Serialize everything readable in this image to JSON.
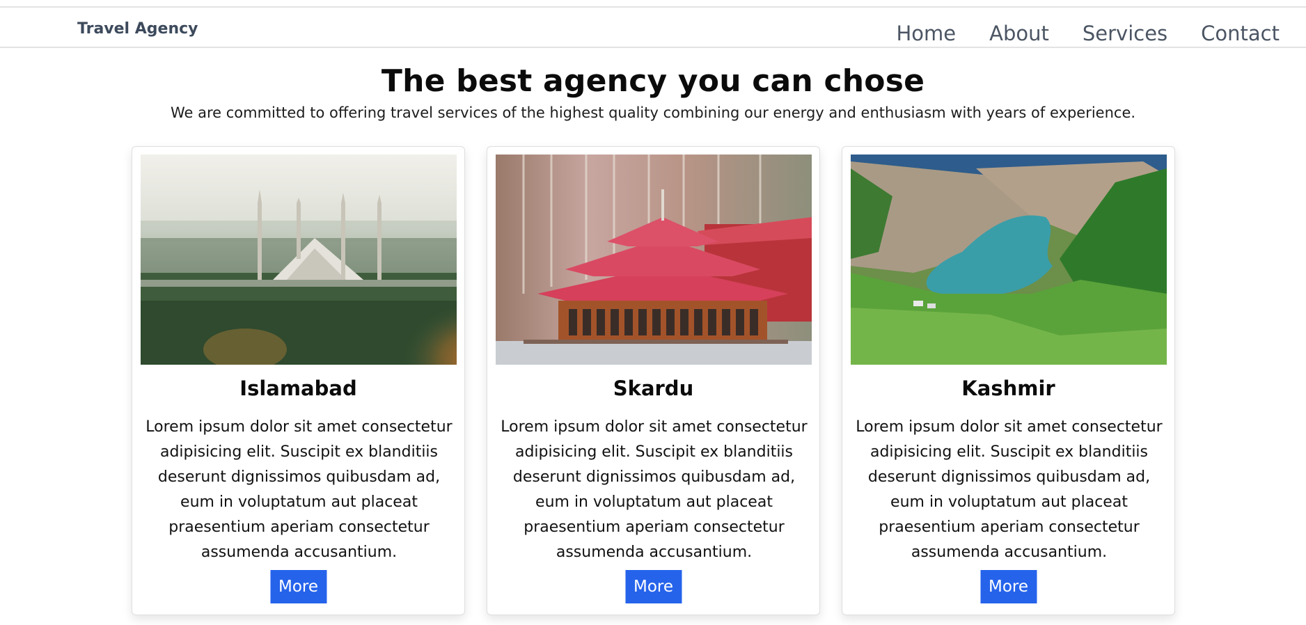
{
  "header": {
    "brand": "Travel Agency",
    "nav": [
      "Home",
      "About",
      "Services",
      "Contact"
    ]
  },
  "hero": {
    "title": "The best agency you can chose",
    "subtitle": "We are committed to offering travel services of the highest quality combining our energy and enthusiasm with years of experience."
  },
  "cards": [
    {
      "title": "Islamabad",
      "image": "mosque-photo",
      "text": "Lorem ipsum dolor sit amet consectetur adipisicing elit. Suscipit ex blanditiis deserunt dignissimos quibusdam ad, eum in voluptatum aut placeat praesentium aperiam consectetur assumenda accusantium.",
      "button": "More"
    },
    {
      "title": "Skardu",
      "image": "pagoda-photo",
      "text": "Lorem ipsum dolor sit amet consectetur adipisicing elit. Suscipit ex blanditiis deserunt dignissimos quibusdam ad, eum in voluptatum aut placeat praesentium aperiam consectetur assumenda accusantium.",
      "button": "More"
    },
    {
      "title": "Kashmir",
      "image": "lake-valley-photo",
      "text": "Lorem ipsum dolor sit amet consectetur adipisicing elit. Suscipit ex blanditiis deserunt dignissimos quibusdam ad, eum in voluptatum aut placeat praesentium aperiam consectetur assumenda accusantium.",
      "button": "More"
    }
  ],
  "colors": {
    "accent": "#2563eb",
    "brand_text": "#3d4a5c",
    "nav_text": "#4b5563"
  }
}
